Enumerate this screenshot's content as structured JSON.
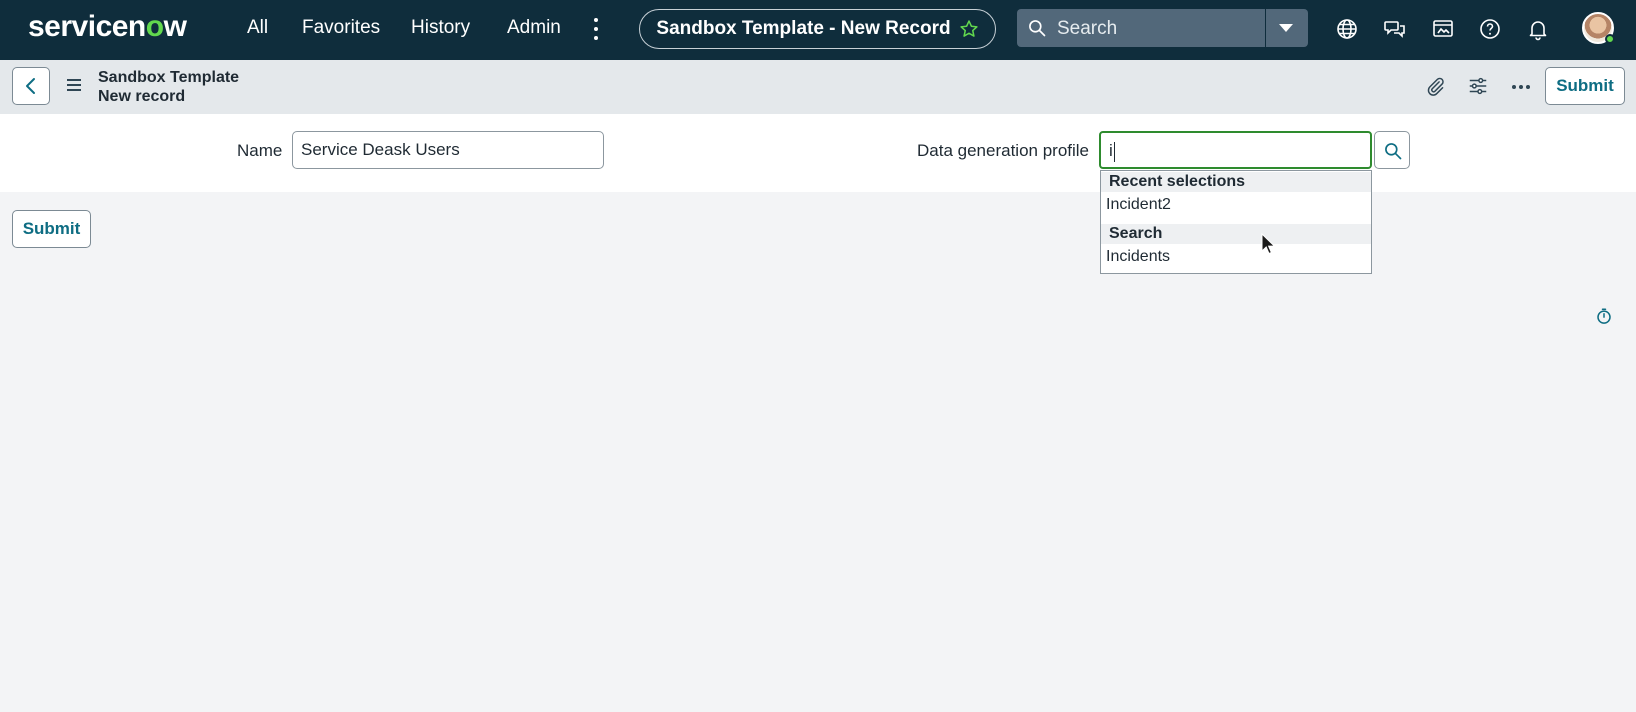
{
  "nav": {
    "logo_pre": "servicen",
    "logo_o": "o",
    "logo_post": "w",
    "links": [
      "All",
      "Favorites",
      "History",
      "Admin"
    ],
    "record_pill": "Sandbox Template - New Record",
    "search_placeholder": "Search"
  },
  "record": {
    "title_line1": "Sandbox Template",
    "title_line2": "New record",
    "submit_label": "Submit"
  },
  "form": {
    "name_label": "Name",
    "name_value": "Service Deask Users",
    "profile_label": "Data generation profile",
    "profile_value": "i"
  },
  "dropdown": {
    "recent_heading": "Recent selections",
    "recent_items": [
      "Incident2"
    ],
    "search_heading": "Search",
    "search_items": [
      "Incidents"
    ]
  },
  "footer": {
    "submit_label": "Submit"
  },
  "colors": {
    "nav_bg": "#0f2d3c",
    "accent_green": "#62d84e",
    "focus_green": "#2e8b2e",
    "button_text": "#0e6d83"
  }
}
